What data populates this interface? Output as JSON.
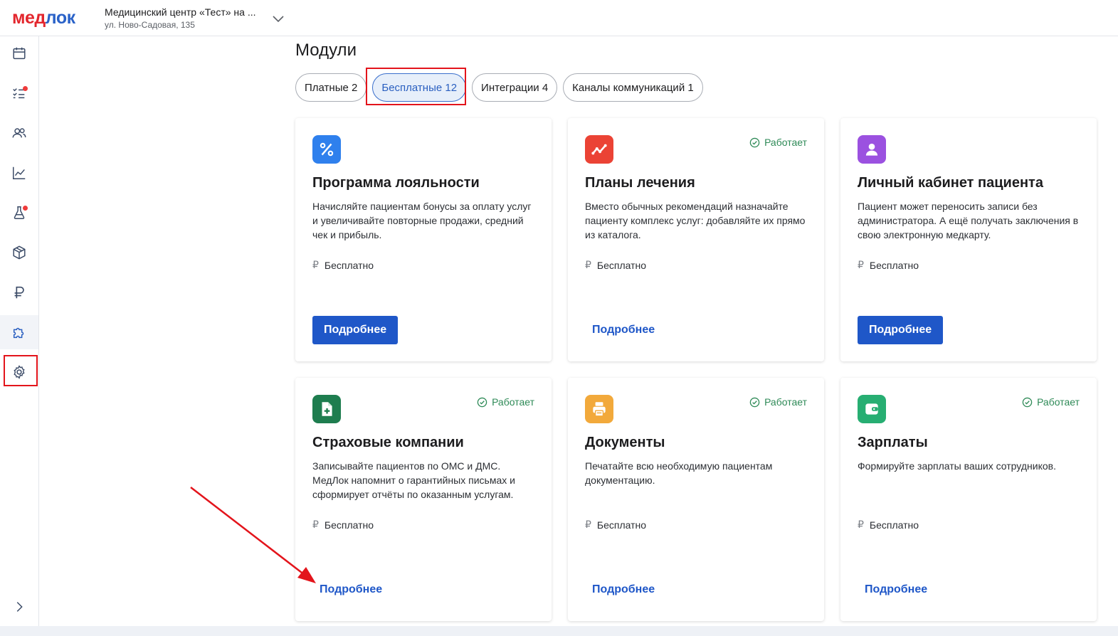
{
  "brand": {
    "logo_part1": "мед",
    "logo_part2": "лок"
  },
  "clinic": {
    "name": "Медицинский центр «Тест» на ...",
    "address": "ул. Ново-Садовая, 135"
  },
  "sidebar": {
    "items": [
      {
        "icon": "calendar-icon"
      },
      {
        "icon": "tasks-icon",
        "badge": true
      },
      {
        "icon": "patients-icon"
      },
      {
        "icon": "analytics-icon"
      },
      {
        "icon": "lab-flask-icon",
        "badge": true
      },
      {
        "icon": "warehouse-box-icon"
      },
      {
        "icon": "ruble-icon"
      },
      {
        "icon": "modules-puzzle-icon",
        "active": true
      },
      {
        "icon": "settings-gear-icon",
        "highlighted": true
      }
    ],
    "expand_icon": "chevron-right-icon"
  },
  "page": {
    "title": "Модули"
  },
  "tabs": [
    {
      "label": "Платные 2"
    },
    {
      "label": "Бесплатные 12",
      "selected": true
    },
    {
      "label": "Интеграции 4"
    },
    {
      "label": "Каналы коммуникаций 1"
    }
  ],
  "status_label": "Работает",
  "cards": [
    {
      "title": "Программа лояльности",
      "description": "Начисляйте пациентам бонусы за оплату услуг и увеличивайте повторные продажи, средний чек и прибыль.",
      "price": "Бесплатно",
      "button": "Подробнее",
      "button_style": "primary",
      "status": "",
      "icon": "percent-icon",
      "icon_color": "#2f80ed"
    },
    {
      "title": "Планы лечения",
      "description": "Вместо обычных рекомендаций назначайте пациенту комплекс услуг: добавляйте их прямо из каталога.",
      "price": "Бесплатно",
      "button": "Подробнее",
      "button_style": "link",
      "status": "Работает",
      "icon": "trend-line-icon",
      "icon_color": "#eb4335"
    },
    {
      "title": "Личный кабинет пациента",
      "description": "Пациент может переносить записи без администратора. А ещё получать заключения в свою электронную медкарту.",
      "price": "Бесплатно",
      "button": "Подробнее",
      "button_style": "primary",
      "status": "",
      "icon": "user-icon",
      "icon_color": "#9b51e0"
    },
    {
      "title": "Страховые компании",
      "description": "Записывайте пациентов по ОМС и ДМС. МедЛок напомнит о гарантийных письмах и сформирует отчёты по оказанным услугам.",
      "price": "Бесплатно",
      "button": "Подробнее",
      "button_style": "link",
      "status": "Работает",
      "icon": "insurance-doc-icon",
      "icon_color": "#1e7d4f"
    },
    {
      "title": "Документы",
      "description": "Печатайте всю необходимую пациентам документацию.",
      "price": "Бесплатно",
      "button": "Подробнее",
      "button_style": "link",
      "status": "Работает",
      "icon": "printer-icon",
      "icon_color": "#f2a93b"
    },
    {
      "title": "Зарплаты",
      "description": "Формируйте зарплаты ваших сотрудников.",
      "price": "Бесплатно",
      "button": "Подробнее",
      "button_style": "link",
      "status": "Работает",
      "icon": "wallet-icon",
      "icon_color": "#27ae72"
    }
  ],
  "colors": {
    "accent": "#1f57c8",
    "status_ok": "#2e8a57",
    "annotation_red": "#e3141b"
  }
}
